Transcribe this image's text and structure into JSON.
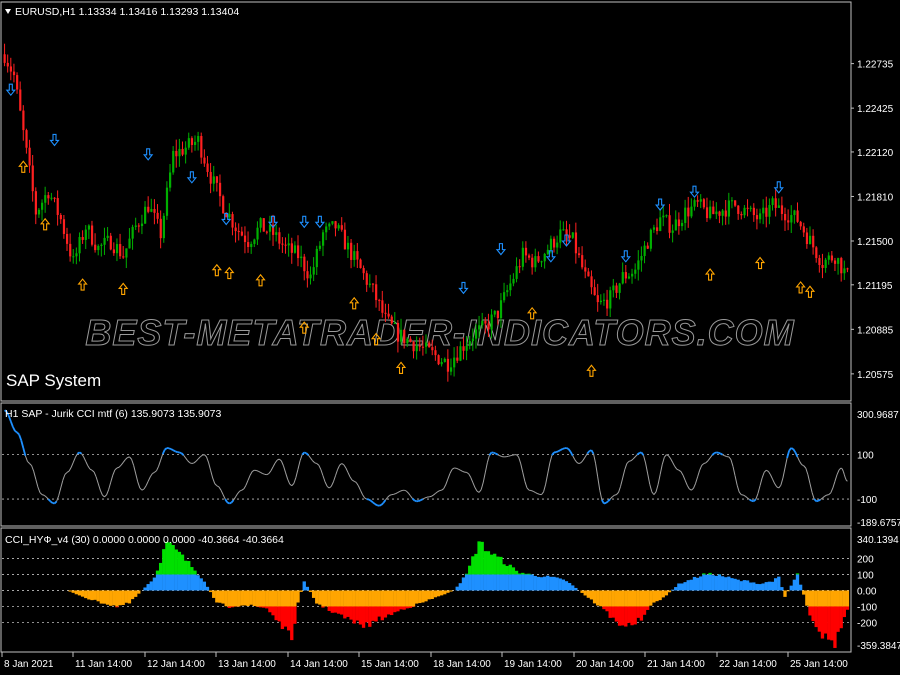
{
  "header": {
    "symbol_info": "EURUSD,H1  1.13334 1.13416 1.13293 1.13404"
  },
  "watermark": "BEST-METATRADER-INDICATORS.COM",
  "colors": {
    "background": "#000000",
    "frame": "#c0c0c0",
    "bull_candle": "#00b000",
    "bear_candle": "#ff2020",
    "down_arrow": "#1e90ff",
    "up_arrow": "#ffa500",
    "cci_line_extreme": "#1e90ff",
    "cci_line_mid": "#a0a0a0",
    "hist_green": "#00e000",
    "hist_blue": "#1e90ff",
    "hist_orange": "#ffa500",
    "hist_red": "#ff0000"
  },
  "chart_data": [
    {
      "type": "candlestick",
      "name": "main",
      "title": "SAP System",
      "symbol": "EURUSD",
      "timeframe": "H1",
      "price_ticks": [
        "1.22735",
        "1.22425",
        "1.22120",
        "1.21810",
        "1.21500",
        "1.21195",
        "1.20885",
        "1.20575"
      ],
      "ylim": [
        1.204,
        1.2315
      ],
      "x_ticks": [
        "8 Jan 2021",
        "11 Jan 14:00",
        "12 Jan 14:00",
        "13 Jan 14:00",
        "14 Jan 14:00",
        "15 Jan 14:00",
        "18 Jan 14:00",
        "19 Jan 14:00",
        "20 Jan 14:00",
        "21 Jan 14:00",
        "22 Jan 14:00",
        "25 Jan 14:00"
      ],
      "close_anchors": [
        [
          0,
          1.228
        ],
        [
          3,
          1.2265
        ],
        [
          6,
          1.2225
        ],
        [
          10,
          1.217
        ],
        [
          14,
          1.2185
        ],
        [
          18,
          1.2165
        ],
        [
          22,
          1.2135
        ],
        [
          26,
          1.216
        ],
        [
          30,
          1.2145
        ],
        [
          34,
          1.215
        ],
        [
          38,
          1.214
        ],
        [
          42,
          1.216
        ],
        [
          46,
          1.2175
        ],
        [
          50,
          1.2155
        ],
        [
          54,
          1.221
        ],
        [
          58,
          1.2215
        ],
        [
          62,
          1.222
        ],
        [
          66,
          1.2195
        ],
        [
          70,
          1.2175
        ],
        [
          74,
          1.216
        ],
        [
          78,
          1.215
        ],
        [
          82,
          1.216
        ],
        [
          86,
          1.2155
        ],
        [
          90,
          1.2145
        ],
        [
          94,
          1.214
        ],
        [
          98,
          1.2125
        ],
        [
          102,
          1.2155
        ],
        [
          106,
          1.216
        ],
        [
          110,
          1.2145
        ],
        [
          114,
          1.213
        ],
        [
          118,
          1.2115
        ],
        [
          122,
          1.2095
        ],
        [
          126,
          1.2085
        ],
        [
          130,
          1.208
        ],
        [
          134,
          1.2075
        ],
        [
          138,
          1.207
        ],
        [
          142,
          1.2065
        ],
        [
          146,
          1.2075
        ],
        [
          150,
          1.2085
        ],
        [
          154,
          1.209
        ],
        [
          158,
          1.21
        ],
        [
          162,
          1.212
        ],
        [
          166,
          1.214
        ],
        [
          170,
          1.2135
        ],
        [
          174,
          1.2145
        ],
        [
          178,
          1.2155
        ],
        [
          182,
          1.215
        ],
        [
          186,
          1.2125
        ],
        [
          190,
          1.2105
        ],
        [
          194,
          1.211
        ],
        [
          198,
          1.2125
        ],
        [
          202,
          1.213
        ],
        [
          206,
          1.215
        ],
        [
          210,
          1.2165
        ],
        [
          214,
          1.216
        ],
        [
          218,
          1.217
        ],
        [
          222,
          1.2175
        ],
        [
          226,
          1.2168
        ],
        [
          230,
          1.2172
        ],
        [
          234,
          1.2175
        ],
        [
          238,
          1.217
        ],
        [
          242,
          1.2165
        ],
        [
          246,
          1.2175
        ],
        [
          250,
          1.217
        ],
        [
          254,
          1.2165
        ],
        [
          258,
          1.215
        ],
        [
          262,
          1.2135
        ],
        [
          266,
          1.214
        ],
        [
          270,
          1.2125
        ]
      ],
      "bars": 271,
      "arrows_down": [
        [
          2,
          1.2255
        ],
        [
          16,
          1.222
        ],
        [
          46,
          1.221
        ],
        [
          60,
          1.2194
        ],
        [
          71,
          1.2165
        ],
        [
          86,
          1.2163
        ],
        [
          96,
          1.2163
        ],
        [
          101,
          1.2163
        ],
        [
          147,
          1.2117
        ],
        [
          159,
          1.2144
        ],
        [
          175,
          1.2139
        ],
        [
          180,
          1.215
        ],
        [
          199,
          1.2139
        ],
        [
          210,
          1.2175
        ],
        [
          221,
          1.2184
        ],
        [
          248,
          1.2187
        ]
      ],
      "arrows_up": [
        [
          6,
          1.2202
        ],
        [
          13,
          1.2162
        ],
        [
          25,
          1.212
        ],
        [
          38,
          1.2117
        ],
        [
          68,
          1.213
        ],
        [
          72,
          1.2128
        ],
        [
          82,
          1.2123
        ],
        [
          96,
          1.209
        ],
        [
          112,
          1.2107
        ],
        [
          119,
          1.2082
        ],
        [
          127,
          1.2062
        ],
        [
          169,
          1.21
        ],
        [
          188,
          1.206
        ],
        [
          226,
          1.2127
        ],
        [
          242,
          1.2135
        ],
        [
          255,
          1.2118
        ],
        [
          258,
          1.2115
        ]
      ]
    },
    {
      "type": "line",
      "name": "cci",
      "title": "H1 SAP - Jurik CCI mtf (6) 135.9073 135.9073",
      "y_ticks": [
        "300.9687",
        "100",
        "-100",
        "-189.6757"
      ],
      "ylim": [
        -189.6757,
        300.9687
      ],
      "levels": [
        100,
        -100
      ],
      "x": [
        0,
        4,
        8,
        12,
        16,
        20,
        24,
        28,
        32,
        36,
        40,
        44,
        48,
        52,
        56,
        60,
        64,
        68,
        72,
        76,
        80,
        84,
        88,
        92,
        96,
        100,
        104,
        108,
        112,
        116,
        120,
        124,
        128,
        132,
        136,
        140,
        144,
        148,
        152,
        156,
        160,
        164,
        168,
        172,
        176,
        180,
        184,
        188,
        192,
        196,
        200,
        204,
        208,
        212,
        216,
        220,
        224,
        228,
        232,
        236,
        240,
        244,
        248,
        252,
        256,
        260,
        264,
        268,
        270
      ],
      "values": [
        300,
        200,
        60,
        -80,
        -120,
        20,
        110,
        30,
        -90,
        40,
        90,
        -60,
        20,
        130,
        110,
        60,
        100,
        -40,
        -120,
        -60,
        30,
        10,
        80,
        -40,
        110,
        60,
        -50,
        60,
        -20,
        -100,
        -130,
        -80,
        -60,
        -110,
        -90,
        -60,
        40,
        20,
        -70,
        110,
        90,
        100,
        -60,
        -80,
        110,
        130,
        60,
        120,
        -120,
        -80,
        70,
        110,
        -80,
        100,
        30,
        -60,
        60,
        110,
        90,
        -80,
        -110,
        30,
        -50,
        130,
        50,
        -110,
        -80,
        40,
        -20
      ]
    },
    {
      "type": "bar",
      "name": "histogram",
      "title": "CCI_HYФ_v4 (30) 0.0000 0.0000 0.0000 -40.3664 -40.3664",
      "y_ticks": [
        "340.1394",
        "200",
        "100",
        "0.00",
        "-100",
        "-200",
        "-359.3847"
      ],
      "ylim": [
        -359.3847,
        340.1394
      ],
      "levels": [
        200,
        100,
        0,
        -100,
        -200
      ],
      "x": [
        0,
        10,
        20,
        28,
        36,
        40,
        44,
        48,
        52,
        56,
        60,
        64,
        68,
        72,
        76,
        80,
        84,
        88,
        92,
        94,
        96,
        100,
        104,
        108,
        112,
        116,
        120,
        124,
        128,
        132,
        136,
        140,
        144,
        148,
        152,
        156,
        160,
        164,
        168,
        172,
        176,
        180,
        184,
        188,
        192,
        196,
        200,
        204,
        208,
        212,
        216,
        220,
        224,
        228,
        232,
        236,
        238,
        242,
        246,
        248,
        250,
        254,
        258,
        262,
        266,
        270
      ],
      "values": [
        0,
        0,
        0,
        -60,
        -100,
        -80,
        0,
        80,
        300,
        230,
        150,
        60,
        -80,
        -100,
        -90,
        -100,
        -110,
        -200,
        -300,
        -80,
        60,
        -80,
        -120,
        -160,
        -200,
        -220,
        -180,
        -150,
        -110,
        -90,
        -60,
        -30,
        0,
        100,
        300,
        230,
        180,
        120,
        100,
        90,
        80,
        60,
        0,
        -60,
        -120,
        -200,
        -220,
        -180,
        -80,
        -30,
        40,
        70,
        100,
        100,
        80,
        60,
        60,
        40,
        60,
        80,
        -40,
        100,
        -150,
        -280,
        -330,
        -120
      ]
    }
  ]
}
